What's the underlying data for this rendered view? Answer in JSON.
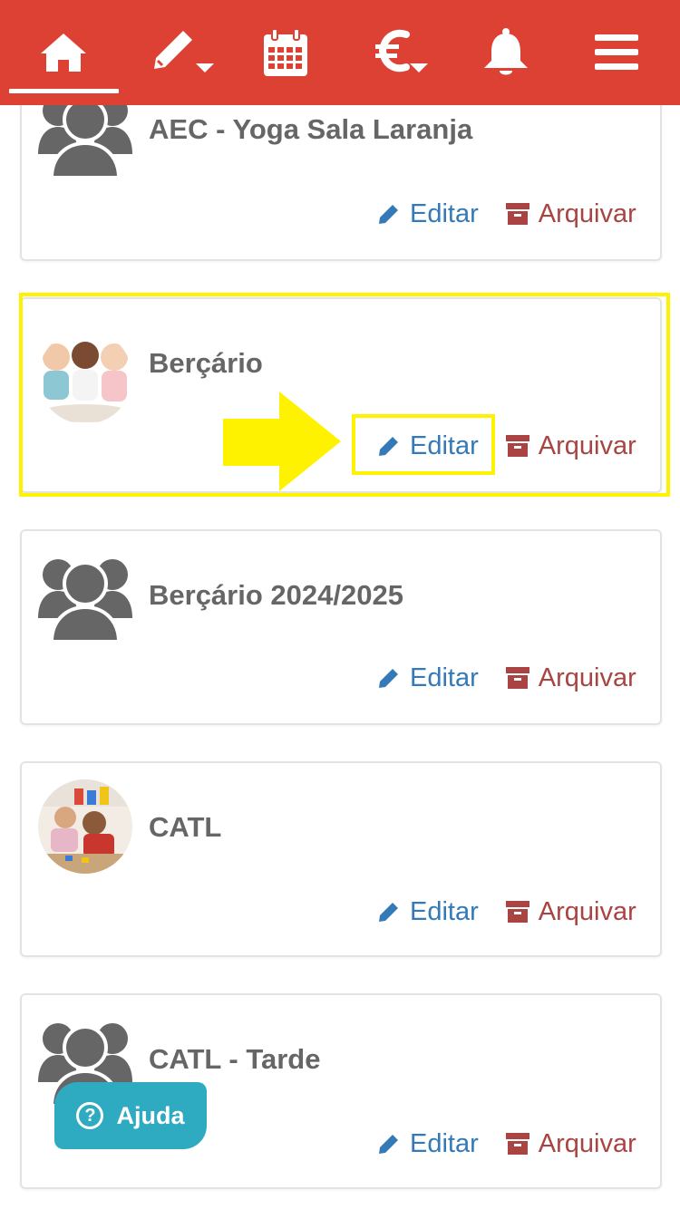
{
  "nav": {
    "items": [
      {
        "icon": "home-icon"
      },
      {
        "icon": "pencil-icon"
      },
      {
        "icon": "calendar-icon"
      },
      {
        "icon": "euro-icon"
      },
      {
        "icon": "bell-icon"
      },
      {
        "icon": "menu-icon"
      }
    ]
  },
  "groups": [
    {
      "name": "AEC - Yoga Sala Laranja",
      "avatar": "group-icon"
    },
    {
      "name": "Berçário",
      "avatar": "babies-photo"
    },
    {
      "name": "Berçário 2024/2025",
      "avatar": "group-icon"
    },
    {
      "name": "CATL",
      "avatar": "children-playing-photo"
    },
    {
      "name": "CATL - Tarde",
      "avatar": "group-icon"
    }
  ],
  "actions": {
    "edit_label": "Editar",
    "archive_label": "Arquivar"
  },
  "help": {
    "label": "Ajuda",
    "icon_glyph": "?"
  },
  "colors": {
    "header": "#dc4134",
    "edit": "#337ab7",
    "archive": "#a94442",
    "highlight": "#fff200",
    "help": "#2eaac1"
  }
}
